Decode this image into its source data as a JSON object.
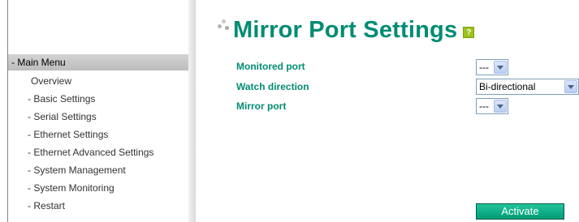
{
  "page": {
    "title": "Mirror Port Settings",
    "help_icon_glyph": "?"
  },
  "menu": {
    "header": "- Main Menu",
    "items": [
      "Overview",
      "- Basic Settings",
      "- Serial Settings",
      "- Ethernet Settings",
      "- Ethernet Advanced Settings",
      "- System Management",
      "- System Monitoring",
      "- Restart"
    ]
  },
  "form": {
    "monitored_port": {
      "label": "Monitored port",
      "value": "---"
    },
    "watch_direction": {
      "label": "Watch direction",
      "value": "Bi-directional"
    },
    "mirror_port": {
      "label": "Mirror port",
      "value": "---"
    }
  },
  "actions": {
    "activate_label": "Activate"
  },
  "colors": {
    "accent": "#008c73",
    "button_green": "#00a07a",
    "help_icon": "#9bc31a"
  }
}
